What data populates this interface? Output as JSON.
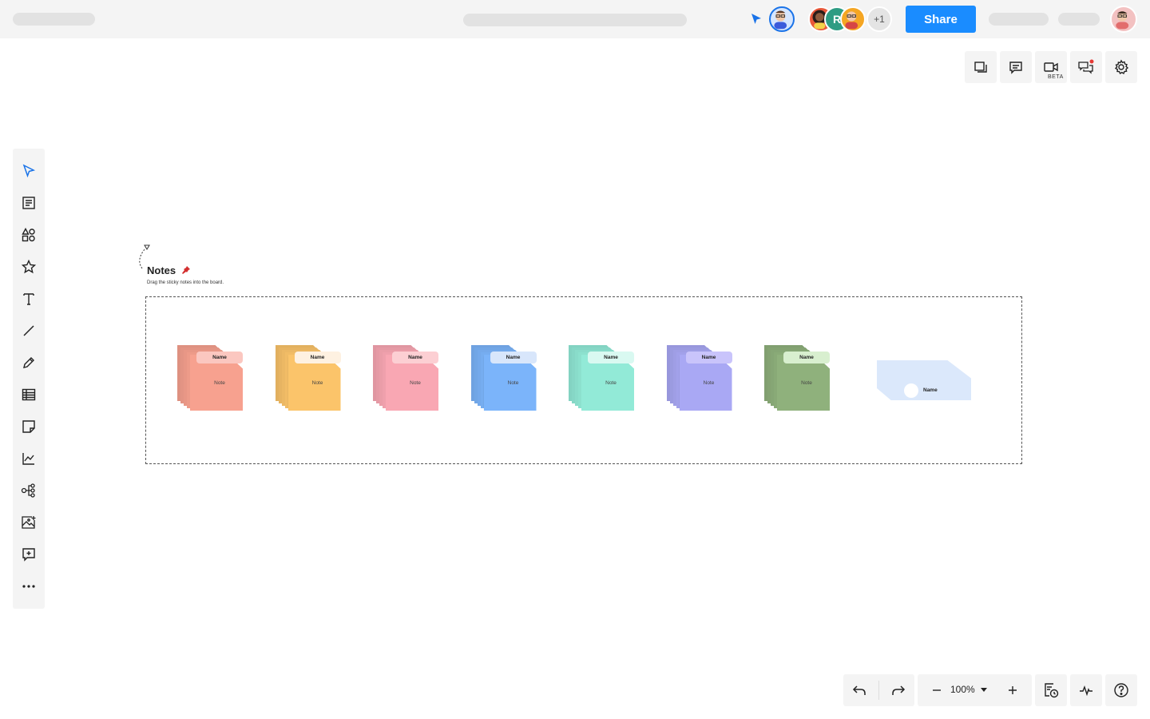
{
  "header": {
    "share_label": "Share",
    "collaborators": [
      {
        "initial": "R"
      },
      {
        "overflow": "+1"
      }
    ]
  },
  "right_tools": {
    "video_badge": "BETA"
  },
  "canvas": {
    "section_title": "Notes",
    "section_hint": "Drag the sticky notes into the board.",
    "note_name_label": "Name",
    "note_body_label": "Note",
    "note_colors": [
      {
        "light": "#fbc7c0",
        "dark": "#f7a18f"
      },
      {
        "light": "#fef1e1",
        "dark": "#fbc46a"
      },
      {
        "light": "#fccfd3",
        "dark": "#f9a7b3"
      },
      {
        "light": "#d8e6fb",
        "dark": "#7bb4fa"
      },
      {
        "light": "#d9f9f1",
        "dark": "#92ead7"
      },
      {
        "light": "#c9c4fb",
        "dark": "#a9a8f4"
      },
      {
        "light": "#d8efcf",
        "dark": "#8fb17c"
      }
    ],
    "name_card_label": "Name"
  },
  "bottom_bar": {
    "zoom": "100%"
  },
  "colors": {
    "accent": "#1a8cff",
    "toolbar_bg": "#f4f4f4"
  }
}
